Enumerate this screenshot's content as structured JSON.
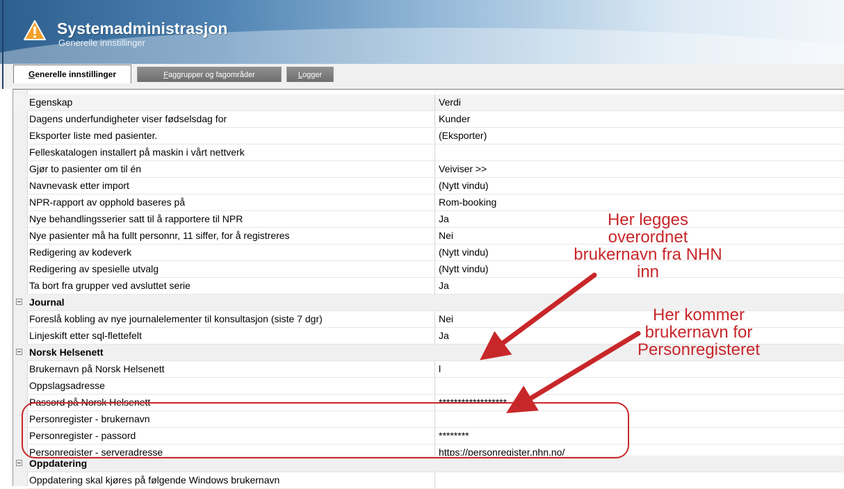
{
  "header": {
    "title": "Systemadministrasjon",
    "subtitle": "Generelle innstillinger"
  },
  "tabs": [
    {
      "label": "Generelle innstillinger",
      "underline": "G",
      "rest": "enerelle innstillinger",
      "active": true
    },
    {
      "label": "Faggrupper og fagområder",
      "underline": "F",
      "rest": "aggrupper og fagområder",
      "active": false
    },
    {
      "label": "Logger",
      "underline": "L",
      "rest": "ogger",
      "active": false
    }
  ],
  "grid": {
    "col_property": "Egenskap",
    "col_value": "Verdi",
    "rows": [
      {
        "property": "Dagens underfundigheter viser fødselsdag for",
        "value": "Kunder"
      },
      {
        "property": "Eksporter liste med pasienter.",
        "value": "(Eksporter)"
      },
      {
        "property": "Felleskatalogen installert på maskin i vårt nettverk",
        "value": ""
      },
      {
        "property": "Gjør to pasienter om til én",
        "value": "Veiviser >>"
      },
      {
        "property": "Navnevask etter import",
        "value": "(Nytt vindu)"
      },
      {
        "property": "NPR-rapport av opphold baseres på",
        "value": "Rom-booking"
      },
      {
        "property": "Nye behandlingsserier satt til å rapportere til NPR",
        "value": "Ja"
      },
      {
        "property": "Nye pasienter må ha fullt personnr, 11 siffer, for å registreres",
        "value": "Nei"
      },
      {
        "property": "Redigering av kodeverk",
        "value": "(Nytt vindu)"
      },
      {
        "property": "Redigering av spesielle utvalg",
        "value": "(Nytt vindu)"
      },
      {
        "property": "Ta bort fra grupper ved avsluttet serie",
        "value": "Ja"
      }
    ],
    "journal_category": "Journal",
    "journal_rows": [
      {
        "property": "Foreslå kobling av nye journalelementer til konsultasjon (siste 7 dgr)",
        "value": "Nei"
      },
      {
        "property": "Linjeskift etter sql-flettefelt",
        "value": "Ja"
      }
    ],
    "nhn_category": "Norsk Helsenett",
    "nhn_rows": [
      {
        "property": "Brukernavn på Norsk Helsenett",
        "value": "l"
      },
      {
        "property": "Oppslagsadresse",
        "value": ""
      },
      {
        "property": "Passord på Norsk Helsenett",
        "value": "******************"
      },
      {
        "property": "Personregister - brukernavn",
        "value": ""
      },
      {
        "property": "Personregister - passord",
        "value": "********"
      },
      {
        "property": "Personregister - serveradresse",
        "value": "https://personregister.nhn.no/"
      }
    ],
    "update_category": "Oppdatering",
    "update_rows": [
      {
        "property": "Oppdatering skal kjøres på følgende Windows brukernavn",
        "value": ""
      }
    ]
  },
  "annotations": {
    "top": [
      "Her legges",
      "overordnet",
      "brukernavn fra NHN",
      "inn"
    ],
    "bottom": [
      "Her kommer",
      "brukernavn for",
      "Personregisteret"
    ],
    "color": "#c8272a"
  },
  "colors": {
    "header_dark": "#2d5f8e",
    "tab_inactive": "#7a7a7a",
    "annotation": "#c8272a"
  }
}
